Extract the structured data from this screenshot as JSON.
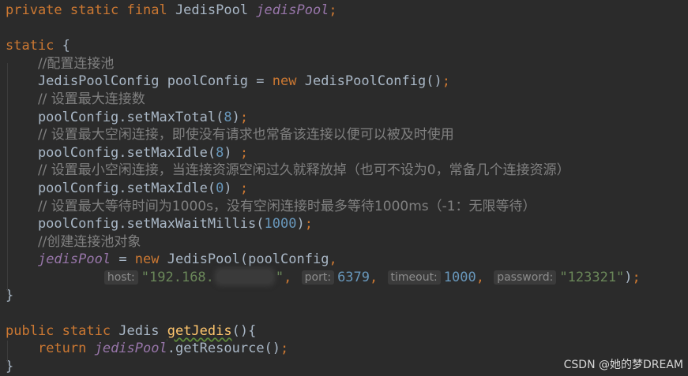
{
  "editor": {
    "lines": [
      [
        [
          "kw",
          "private static final "
        ],
        [
          "plain",
          "JedisPool "
        ],
        [
          "fld",
          "jedisPool"
        ],
        [
          "kw",
          ";"
        ]
      ],
      [],
      [
        [
          "kw",
          "static "
        ],
        [
          "plain",
          "{"
        ]
      ],
      [
        [
          "plain",
          "    "
        ],
        [
          "cm",
          "//配置连接池"
        ]
      ],
      [
        [
          "plain",
          "    JedisPoolConfig poolConfig = "
        ],
        [
          "kw",
          "new "
        ],
        [
          "plain",
          "JedisPoolConfig()"
        ],
        [
          "kw",
          ";"
        ]
      ],
      [
        [
          "plain",
          "    "
        ],
        [
          "cm",
          "// 设置最大连接数"
        ]
      ],
      [
        [
          "plain",
          "    poolConfig.setMaxTotal("
        ],
        [
          "num",
          "8"
        ],
        [
          "plain",
          ")"
        ],
        [
          "kw",
          ";"
        ]
      ],
      [
        [
          "plain",
          "    "
        ],
        [
          "cm",
          "// 设置最大空闲连接，即使没有请求也常备该连接以便可以被及时使用"
        ]
      ],
      [
        [
          "plain",
          "    poolConfig.setMaxIdle("
        ],
        [
          "num",
          "8"
        ],
        [
          "plain",
          ") "
        ],
        [
          "kw",
          ";"
        ]
      ],
      [
        [
          "plain",
          "    "
        ],
        [
          "cm",
          "// 设置最小空闲连接，当连接资源空闲过久就释放掉（也可不设为0，常备几个连接资源）"
        ]
      ],
      [
        [
          "plain",
          "    poolConfig.setMaxIdle("
        ],
        [
          "num",
          "0"
        ],
        [
          "plain",
          ") "
        ],
        [
          "kw",
          ";"
        ]
      ],
      [
        [
          "plain",
          "    "
        ],
        [
          "cm",
          "// 设置最大等待时间为1000s，没有空闲连接时最多等待1000ms（-1：无限等待）"
        ]
      ],
      [
        [
          "plain",
          "    poolConfig.setMaxWaitMillis("
        ],
        [
          "num",
          "1000"
        ],
        [
          "plain",
          ")"
        ],
        [
          "kw",
          ";"
        ]
      ],
      [
        [
          "plain",
          "    "
        ],
        [
          "cm",
          "//创建连接池对象"
        ]
      ],
      [
        [
          "plain",
          "    "
        ],
        [
          "fld",
          "jedisPool"
        ],
        [
          "plain",
          " = "
        ],
        [
          "kw",
          "new "
        ],
        [
          "plain",
          "JedisPool(poolConfig"
        ],
        [
          "kw",
          ","
        ]
      ],
      [
        [
          "plain",
          "            "
        ],
        [
          "hint",
          "host:"
        ],
        [
          "str",
          "\"192.168."
        ],
        [
          "blur",
          ""
        ],
        [
          "str",
          "\""
        ],
        [
          "kw",
          ", "
        ],
        [
          "hint",
          "port:"
        ],
        [
          "num",
          "6379"
        ],
        [
          "kw",
          ", "
        ],
        [
          "hint",
          "timeout:"
        ],
        [
          "num",
          "1000"
        ],
        [
          "kw",
          ", "
        ],
        [
          "hint",
          "password:"
        ],
        [
          "str",
          "\"123321\""
        ],
        [
          "plain",
          ")"
        ],
        [
          "kw",
          ";"
        ]
      ],
      [
        [
          "plain",
          "}"
        ]
      ],
      [],
      [
        [
          "kw",
          "public static "
        ],
        [
          "plain",
          "Jedis "
        ],
        [
          "fn-sq",
          "getJedis"
        ],
        [
          "plain",
          "(){"
        ]
      ],
      [
        [
          "plain",
          "    "
        ],
        [
          "kw",
          "return "
        ],
        [
          "fld",
          "jedisPool"
        ],
        [
          "plain",
          ".getResource()"
        ],
        [
          "kw",
          ";"
        ]
      ],
      [
        [
          "plain",
          "}"
        ]
      ]
    ]
  },
  "watermark": "CSDN @她的梦DREAM"
}
